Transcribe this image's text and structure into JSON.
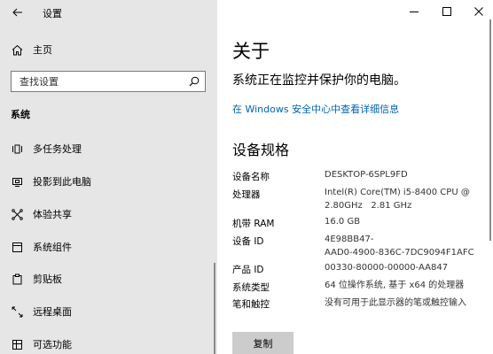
{
  "window": {
    "app_title": "设置",
    "back_icon": "arrow-left-icon",
    "minimize_icon": "minimize-icon",
    "maximize_icon": "maximize-icon",
    "close_icon": "close-icon"
  },
  "sidebar": {
    "home": {
      "label": "主页",
      "icon": "home-icon"
    },
    "search": {
      "placeholder": "查找设置",
      "icon": "search-icon"
    },
    "section": "系统",
    "items": [
      {
        "label": "多任务处理",
        "icon": "multitasking-icon"
      },
      {
        "label": "投影到此电脑",
        "icon": "projecting-icon"
      },
      {
        "label": "体验共享",
        "icon": "shared-experiences-icon"
      },
      {
        "label": "系统组件",
        "icon": "system-components-icon"
      },
      {
        "label": "剪贴板",
        "icon": "clipboard-icon"
      },
      {
        "label": "远程桌面",
        "icon": "remote-desktop-icon"
      },
      {
        "label": "可选功能",
        "icon": "optional-features-icon"
      }
    ]
  },
  "main": {
    "title": "关于",
    "protect_text": "系统正在监控并保护你的电脑。",
    "security_link": "在 Windows 安全中心中查看详细信息",
    "specs_title": "设备规格",
    "specs": [
      {
        "label": "设备名称",
        "value": [
          "DESKTOP-6SPL9FD"
        ]
      },
      {
        "label": "处理器",
        "value": [
          "Intel(R) Core(TM) i5-8400 CPU @",
          "2.80GHz   2.81 GHz"
        ]
      },
      {
        "label": "机带 RAM",
        "value": [
          "16.0 GB"
        ]
      },
      {
        "label": "设备 ID",
        "value": [
          "4E98BB47-",
          "AAD0-4900-836C-7DC9094F1AFC"
        ]
      },
      {
        "label": "产品 ID",
        "value": [
          "00330-80000-00000-AA847"
        ]
      },
      {
        "label": "系统类型",
        "value": [
          "64 位操作系统, 基于 x64 的处理器"
        ]
      },
      {
        "label": "笔和触控",
        "value": [
          "没有可用于此显示器的笔或触控输入"
        ]
      }
    ],
    "copy_button": "复制"
  },
  "colors": {
    "sidebar_bg": "#e6e6e6",
    "link": "#0063b1",
    "button_bg": "#cccccc"
  }
}
